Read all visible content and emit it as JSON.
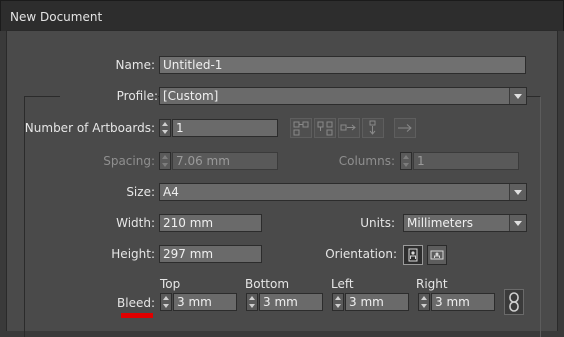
{
  "window": {
    "title": "New Document"
  },
  "name": {
    "label": "Name:",
    "value": "Untitled-1"
  },
  "profile": {
    "label": "Profile:",
    "value": "[Custom]"
  },
  "artboards": {
    "label": "Number of Artboards:",
    "value": "1",
    "layout_icons": [
      "grid-by-row-icon",
      "grid-by-column-icon",
      "arrange-by-row-icon",
      "arrange-by-column-icon",
      "right-to-left-layout-icon"
    ]
  },
  "spacing": {
    "label": "Spacing:",
    "value": "7.06 mm"
  },
  "columns": {
    "label": "Columns:",
    "value": "1"
  },
  "size": {
    "label": "Size:",
    "value": "A4"
  },
  "width": {
    "label": "Width:",
    "value": "210 mm"
  },
  "units": {
    "label": "Units:",
    "value": "Millimeters"
  },
  "height": {
    "label": "Height:",
    "value": "297 mm"
  },
  "orientation": {
    "label": "Orientation:",
    "selected": "portrait"
  },
  "bleed": {
    "label": "Bleed:",
    "top": {
      "label": "Top",
      "value": "3 mm"
    },
    "bottom": {
      "label": "Bottom",
      "value": "3 mm"
    },
    "left": {
      "label": "Left",
      "value": "3 mm"
    },
    "right": {
      "label": "Right",
      "value": "3 mm"
    }
  },
  "colors": {
    "bleed_underline": "#e00000"
  }
}
